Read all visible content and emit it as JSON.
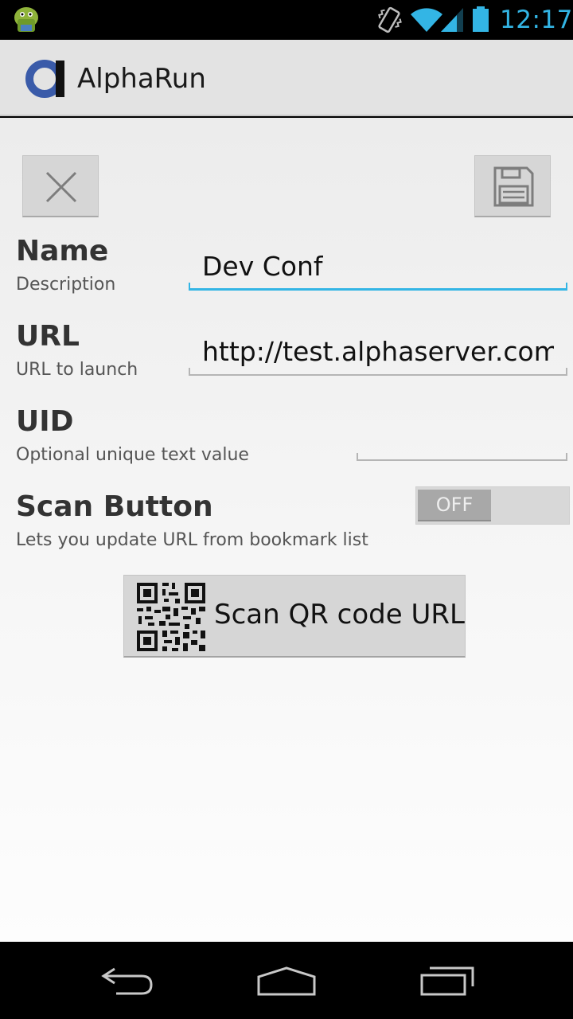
{
  "status_bar": {
    "time": "12:17",
    "icons": [
      "android-notification-icon",
      "vibrate-icon",
      "wifi-icon",
      "signal-icon",
      "battery-icon"
    ],
    "accent_color": "#33b5e5"
  },
  "action_bar": {
    "title": "AlphaRun",
    "logo_icon": "alpharun-logo-icon",
    "logo_color": "#3a5ba9"
  },
  "toolbar": {
    "cancel_icon": "close-icon",
    "save_icon": "save-floppy-icon"
  },
  "form": {
    "name": {
      "label": "Name",
      "sublabel": "Description",
      "value": "Dev Conf",
      "focused": true
    },
    "url": {
      "label": "URL",
      "sublabel": "URL to launch",
      "value": "http://test.alphaserver.com/"
    },
    "uid": {
      "label": "UID",
      "sublabel": "Optional unique text value",
      "value": ""
    },
    "scan_button": {
      "label": "Scan Button",
      "sublabel": "Lets you update URL from bookmark list",
      "toggle_state": "OFF"
    }
  },
  "qr_button": {
    "label": "Scan QR code URL",
    "icon": "qr-code-icon"
  },
  "nav_bar": {
    "icons": [
      "back-icon",
      "home-icon",
      "recent-apps-icon"
    ]
  }
}
